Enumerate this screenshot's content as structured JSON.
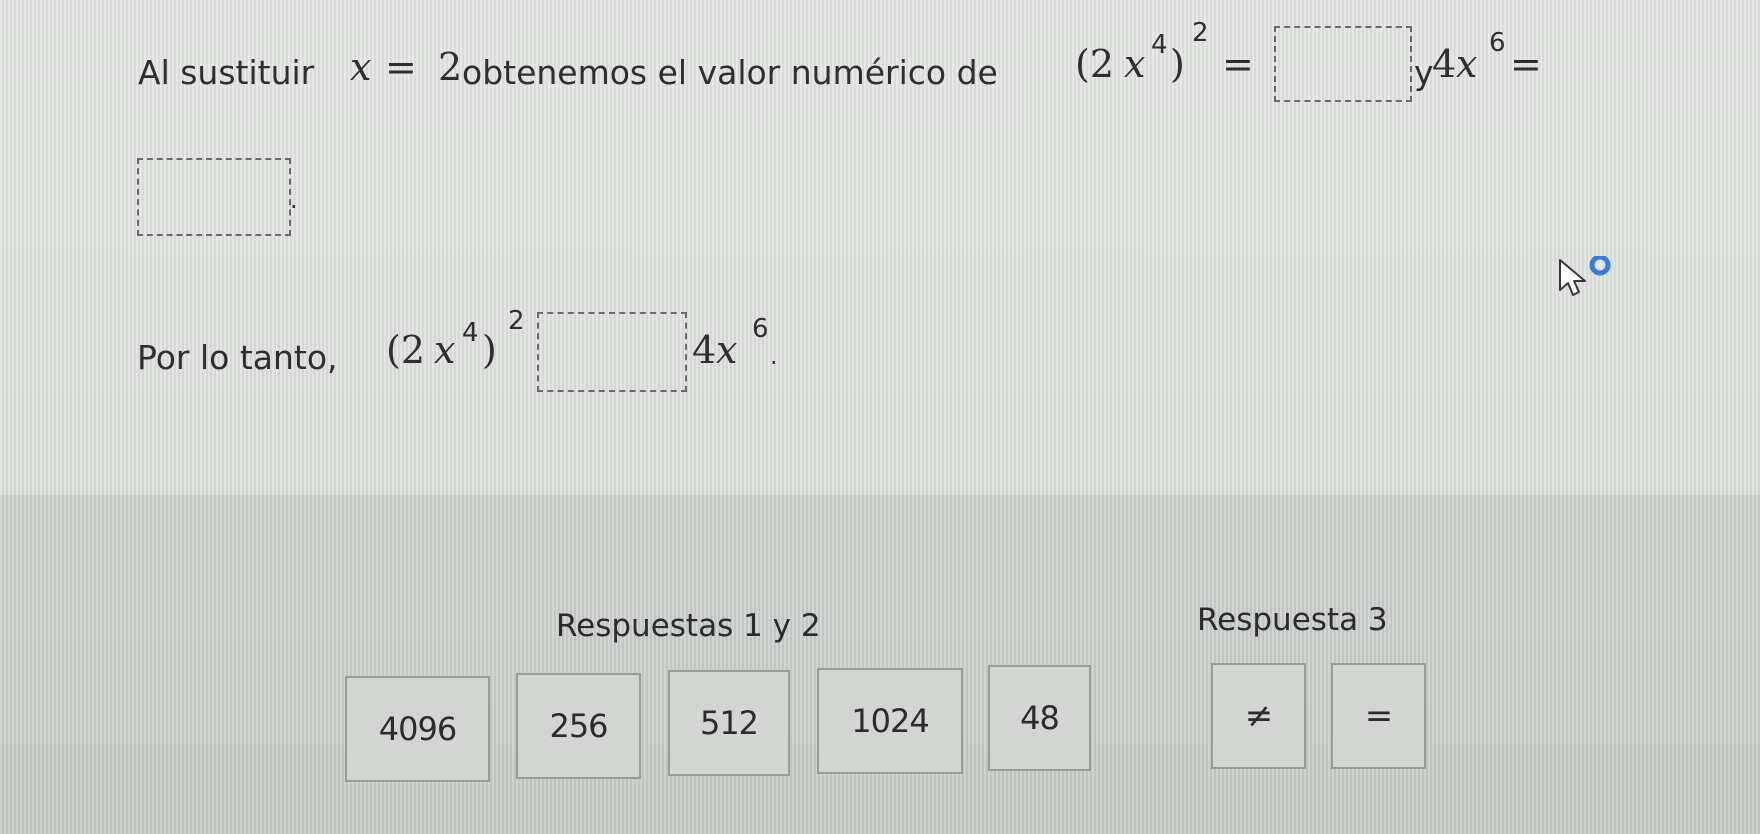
{
  "question": {
    "intro": "Al sustituir",
    "var_x": "x",
    "equals": "=",
    "value": "2",
    "middle": "obtenemos el valor numérico de",
    "expr1_open": "(2",
    "expr1_var": "x",
    "expr1_exp": "4",
    "expr1_close": ")",
    "expr1_outer_exp": "2",
    "expr1_eq": "=",
    "connector": "y",
    "expr2_coef": "4",
    "expr2_var": "x",
    "expr2_exp": "6",
    "expr2_eq": "=",
    "period": "."
  },
  "conclusion": {
    "intro": "Por lo tanto,",
    "expr1_open": "(2",
    "expr1_var": "x",
    "expr1_exp": "4",
    "expr1_close": ")",
    "expr1_outer_exp": "2",
    "expr2_coef": "4",
    "expr2_var": "x",
    "expr2_exp": "6",
    "period": "."
  },
  "answers": {
    "group1_title": "Respuestas 1 y 2",
    "group2_title": "Respuesta 3",
    "group1_options": [
      "4096",
      "256",
      "512",
      "1024",
      "48"
    ],
    "group2_options": [
      "≠",
      "="
    ]
  },
  "colors": {
    "text": "#2f2f2f",
    "tile_border": "#9a9c9a",
    "tile_bg": "#d2d5d2",
    "cursor_ring": "#3a7bd5"
  },
  "icons": {
    "cursor": "mouse-pointer-icon",
    "loading": "loading-ring-icon"
  }
}
